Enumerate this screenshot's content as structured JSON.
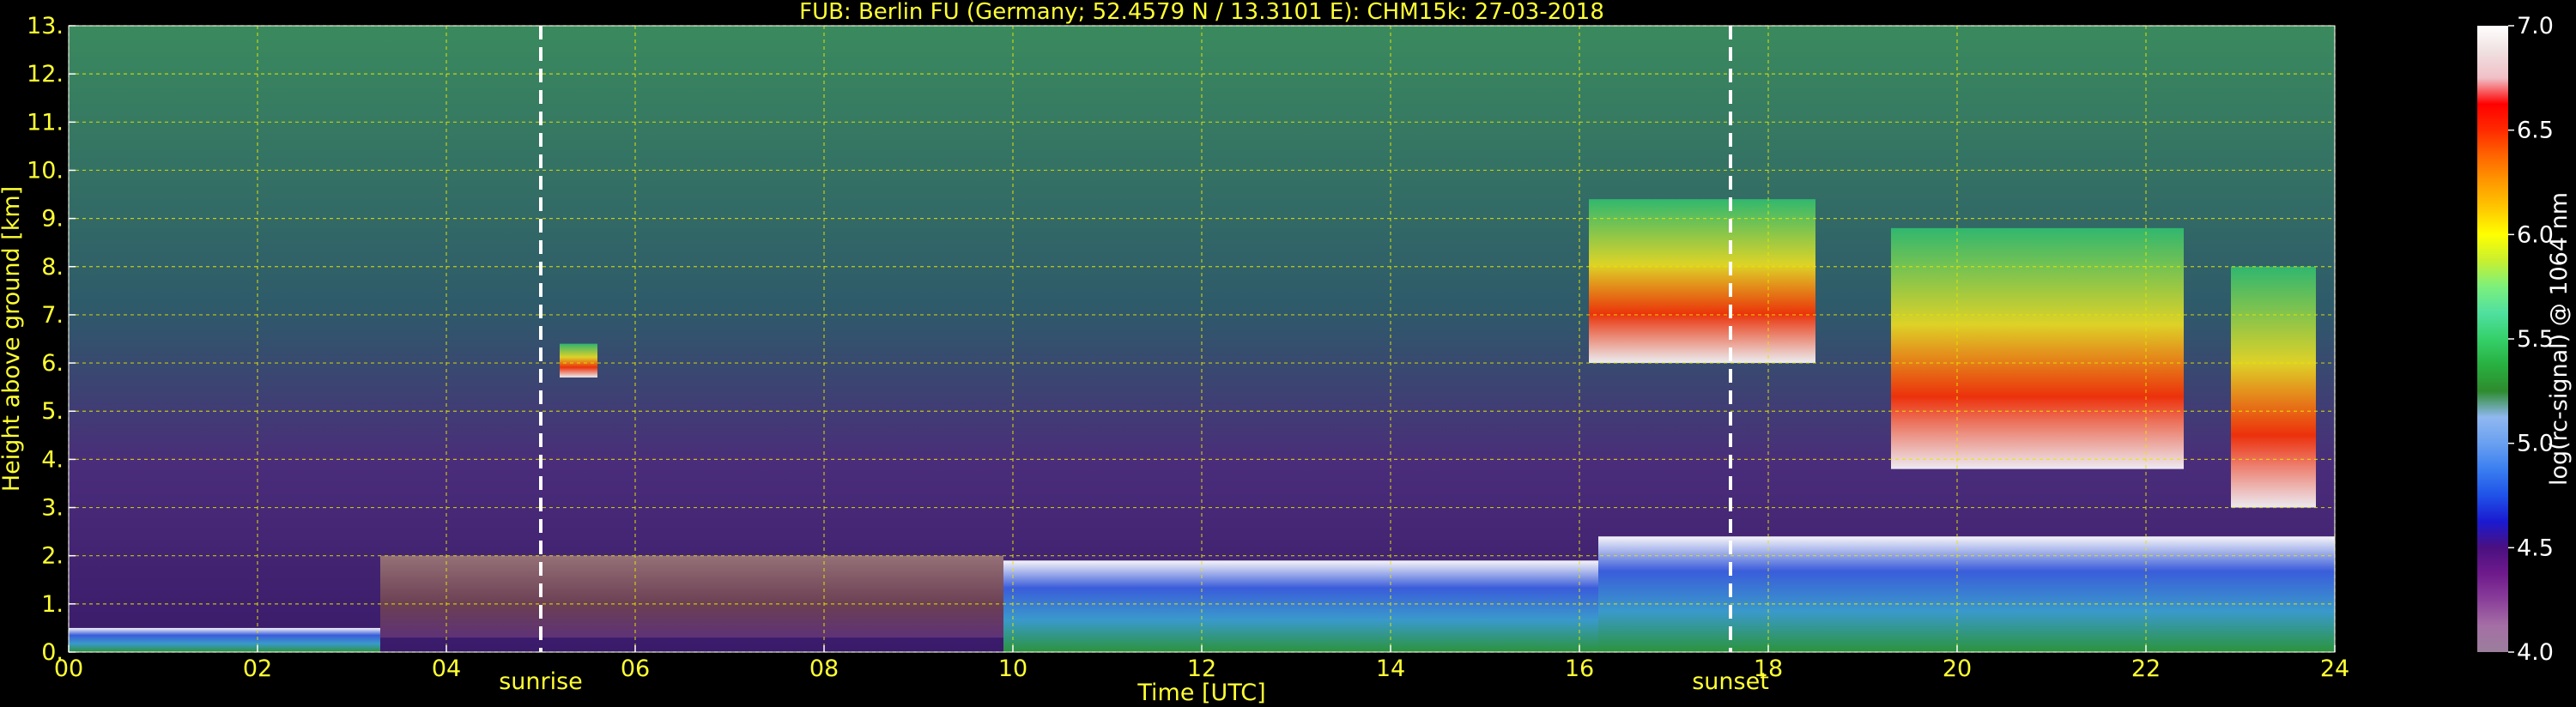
{
  "chart_data": {
    "type": "heatmap",
    "title": "FUB: Berlin FU (Germany; 52.4579 N / 13.3101 E):    CHM15k: 27-03-2018",
    "xlabel": "Time [UTC]",
    "ylabel": "Height above ground [km]",
    "xlim": [
      0,
      24
    ],
    "ylim": [
      0,
      13
    ],
    "x_ticks": [
      "00",
      "02",
      "04",
      "06",
      "08",
      "10",
      "12",
      "14",
      "16",
      "18",
      "20",
      "22",
      "24"
    ],
    "y_ticks": [
      "0.",
      "1.",
      "2.",
      "3.",
      "4.",
      "5.",
      "6.",
      "7.",
      "8.",
      "9.",
      "10.",
      "11.",
      "12.",
      "13."
    ],
    "grid": true,
    "markers": [
      {
        "label": "sunrise",
        "time": 5.0
      },
      {
        "label": "sunset",
        "time": 17.6
      }
    ],
    "colorbar": {
      "label": "log(rc-signal) @ 1064 nm",
      "range": [
        4.0,
        7.0
      ],
      "ticks": [
        "4.0",
        "4.5",
        "5.0",
        "5.5",
        "6.0",
        "6.5",
        "7.0"
      ],
      "colors": [
        "#9a7f9c",
        "#a56fa5",
        "#8a3f9a",
        "#6e1a8c",
        "#4a1080",
        "#1a1ad0",
        "#1f52e8",
        "#3a7ef0",
        "#6aa0f0",
        "#90b8f0",
        "#2e8b2e",
        "#28b040",
        "#35d06a",
        "#50e0a0",
        "#7cf07c",
        "#c8f030",
        "#ffff00",
        "#ffc800",
        "#ff9a00",
        "#ff6600",
        "#ff2a00",
        "#ff0000",
        "#f0c0c8",
        "#f0e0e0",
        "#ffffff"
      ]
    },
    "features": [
      {
        "kind": "boundary-layer",
        "start": 0.0,
        "end": 3.3,
        "bottom": 0.0,
        "top": 0.5
      },
      {
        "kind": "residual-layer",
        "start": 3.3,
        "end": 9.9,
        "bottom": 0.3,
        "top": 2.0
      },
      {
        "kind": "boundary-layer",
        "start": 9.9,
        "end": 16.2,
        "bottom": 0.0,
        "top": 1.9
      },
      {
        "kind": "boundary-layer",
        "start": 16.2,
        "end": 24.0,
        "bottom": 0.0,
        "top": 2.4
      },
      {
        "kind": "cloud",
        "start": 5.2,
        "end": 5.6,
        "bottom": 5.7,
        "top": 6.4
      },
      {
        "kind": "cloud",
        "start": 16.1,
        "end": 18.5,
        "bottom": 6.0,
        "top": 9.4
      },
      {
        "kind": "cloud",
        "start": 19.3,
        "end": 22.4,
        "bottom": 3.8,
        "top": 8.8
      },
      {
        "kind": "cloud",
        "start": 22.9,
        "end": 23.8,
        "bottom": 3.0,
        "top": 8.0
      }
    ]
  }
}
